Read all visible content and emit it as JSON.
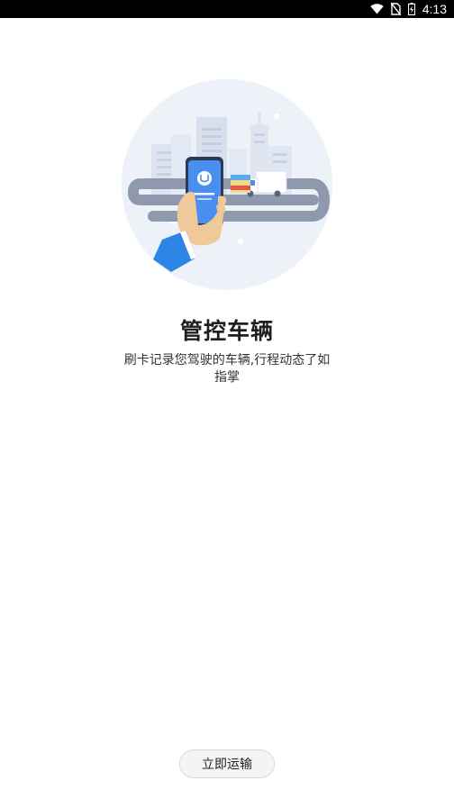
{
  "status_bar": {
    "time": "4:13",
    "icons": [
      "wifi-icon",
      "no-sim-icon",
      "battery-charging-icon"
    ]
  },
  "hero": {
    "illustration": "hand-holding-phone-city-truck-illustration"
  },
  "content": {
    "title": "管控车辆",
    "description": "刷卡记录您驾驶的车辆,行程动态了如指掌"
  },
  "action": {
    "start_label": "立即运输"
  },
  "colors": {
    "accent_blue": "#4a8ff0",
    "circle_bg": "#edf1f8",
    "road": "#8e99ad",
    "skin": "#f0c99a",
    "sleeve": "#2d86e6"
  }
}
